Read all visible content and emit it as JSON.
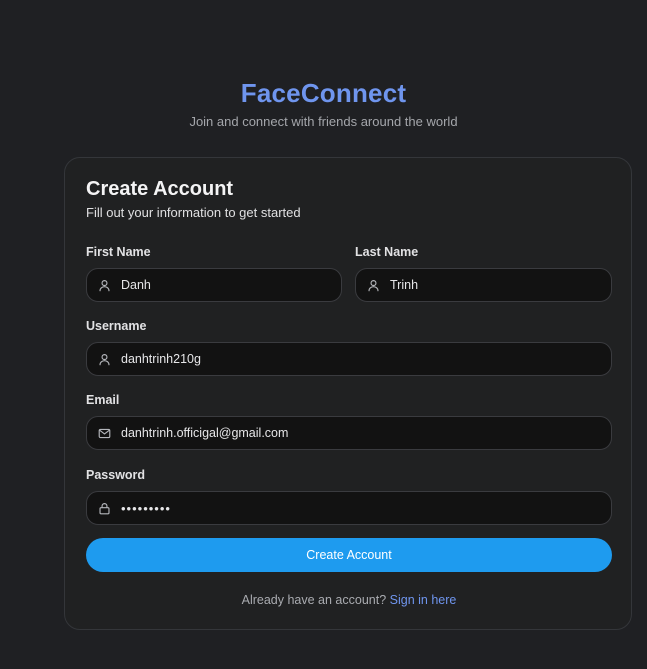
{
  "brand": {
    "title": "FaceConnect",
    "tagline": "Join and connect with friends around the world"
  },
  "form": {
    "title": "Create Account",
    "subtitle": "Fill out your information to get started",
    "first_name": {
      "label": "First Name",
      "value": "Danh",
      "icon": "user-icon"
    },
    "last_name": {
      "label": "Last Name",
      "value": "Trinh",
      "icon": "user-icon"
    },
    "username": {
      "label": "Username",
      "value": "danhtrinh210g",
      "icon": "user-icon"
    },
    "email": {
      "label": "Email",
      "value": "danhtrinh.officigal@gmail.com",
      "icon": "mail-icon"
    },
    "password": {
      "label": "Password",
      "value": "•••••••••",
      "icon": "lock-icon"
    },
    "submit_label": "Create Account",
    "footer_text": "Already have an account?",
    "signin_link": "Sign in here"
  },
  "colors": {
    "background": "#1f2023",
    "card": "#202122",
    "brand": "#6f95ee",
    "primary_button": "#1e9bef",
    "input_bg": "#121212"
  }
}
